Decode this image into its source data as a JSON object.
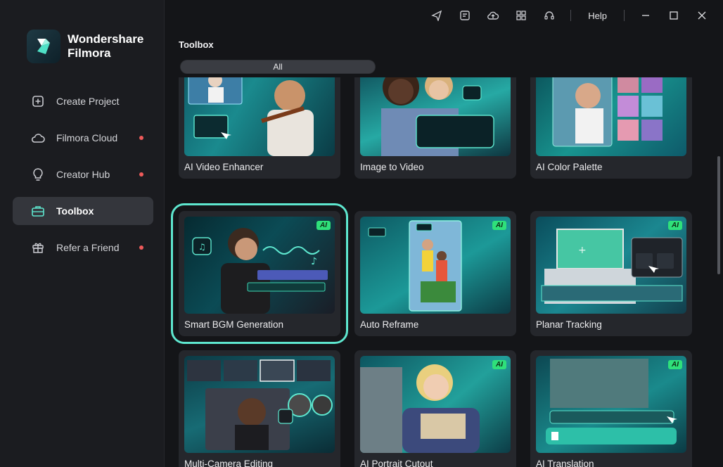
{
  "app": {
    "brand_line1": "Wondershare",
    "brand_line2": "Filmora"
  },
  "sidebar": {
    "items": [
      {
        "label": "Create Project",
        "icon": "plus-square-icon",
        "dot": false,
        "active": false
      },
      {
        "label": "Filmora Cloud",
        "icon": "cloud-icon",
        "dot": true,
        "active": false
      },
      {
        "label": "Creator Hub",
        "icon": "lightbulb-icon",
        "dot": true,
        "active": false
      },
      {
        "label": "Toolbox",
        "icon": "toolbox-icon",
        "dot": false,
        "active": true
      },
      {
        "label": "Refer a Friend",
        "icon": "gift-icon",
        "dot": true,
        "active": false
      }
    ]
  },
  "titlebar": {
    "help_label": "Help",
    "icons": [
      "send-icon",
      "news-icon",
      "cloud-upload-icon",
      "grid-icon",
      "headset-icon"
    ]
  },
  "main": {
    "title": "Toolbox",
    "filter_label": "All",
    "ai_badge": "AI",
    "cards": [
      {
        "label": "AI Video Enhancer",
        "ai": true
      },
      {
        "label": "Image to Video",
        "ai": true
      },
      {
        "label": "AI Color Palette",
        "ai": true
      },
      {
        "label": "Smart BGM Generation",
        "ai": true,
        "selected": true
      },
      {
        "label": "Auto Reframe",
        "ai": true
      },
      {
        "label": "Planar Tracking",
        "ai": true
      },
      {
        "label": "Multi-Camera Editing",
        "ai": false
      },
      {
        "label": "AI Portrait Cutout",
        "ai": true
      },
      {
        "label": "AI Translation",
        "ai": true
      }
    ]
  },
  "colors": {
    "accent": "#5ee7cf",
    "ai_badge": "#2fe07a",
    "notification_dot": "#ef5a5a"
  }
}
